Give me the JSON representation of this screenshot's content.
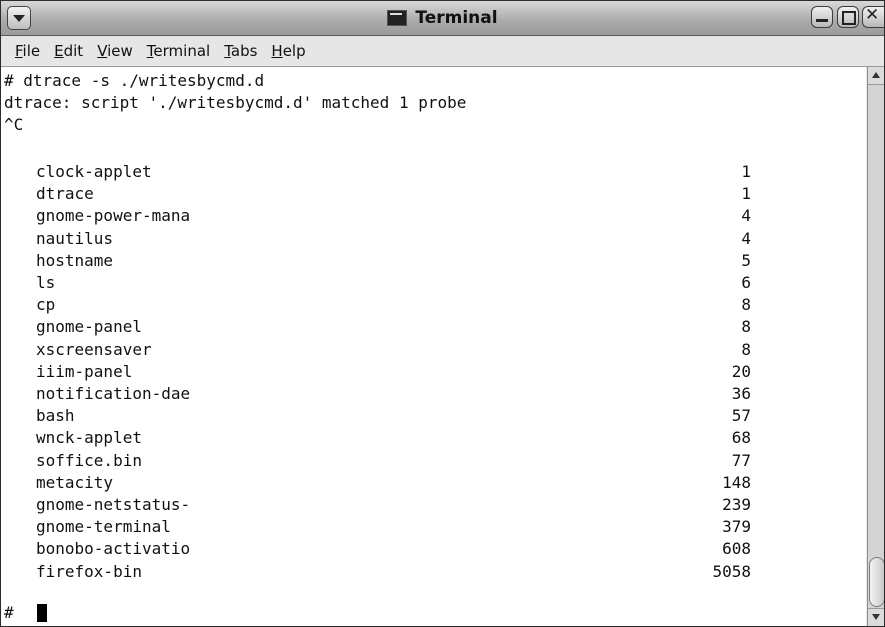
{
  "window": {
    "title": "Terminal"
  },
  "menu": {
    "file": "File",
    "edit": "Edit",
    "view": "View",
    "terminal": "Terminal",
    "tabs": "Tabs",
    "help": "Help"
  },
  "terminal": {
    "lines": [
      "# dtrace -s ./writesbycmd.d",
      "dtrace: script './writesbycmd.d' matched 1 probe",
      "^C"
    ],
    "rows": [
      {
        "name": "clock-applet",
        "count": "1"
      },
      {
        "name": "dtrace",
        "count": "1"
      },
      {
        "name": "gnome-power-mana",
        "count": "4"
      },
      {
        "name": "nautilus",
        "count": "4"
      },
      {
        "name": "hostname",
        "count": "5"
      },
      {
        "name": "ls",
        "count": "6"
      },
      {
        "name": "cp",
        "count": "8"
      },
      {
        "name": "gnome-panel",
        "count": "8"
      },
      {
        "name": "xscreensaver",
        "count": "8"
      },
      {
        "name": "iiim-panel",
        "count": "20"
      },
      {
        "name": "notification-dae",
        "count": "36"
      },
      {
        "name": "bash",
        "count": "57"
      },
      {
        "name": "wnck-applet",
        "count": "68"
      },
      {
        "name": "soffice.bin",
        "count": "77"
      },
      {
        "name": "metacity",
        "count": "148"
      },
      {
        "name": "gnome-netstatus-",
        "count": "239"
      },
      {
        "name": "gnome-terminal",
        "count": "379"
      },
      {
        "name": "bonobo-activatio",
        "count": "608"
      },
      {
        "name": "firefox-bin",
        "count": "5058"
      }
    ],
    "prompt": "#"
  },
  "icons": {
    "window_menu": "window-menu-icon",
    "app": "terminal-icon",
    "minimize": "minimize-icon",
    "maximize": "maximize-icon",
    "close": "close-icon"
  }
}
